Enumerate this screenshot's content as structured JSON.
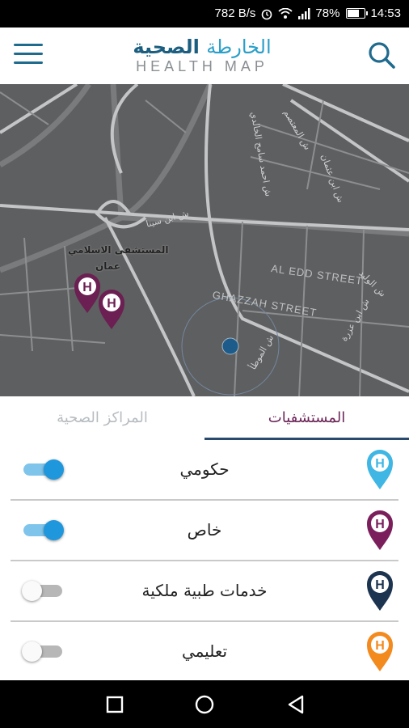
{
  "status_bar": {
    "net_speed": "782 B/s",
    "battery_text": "78%",
    "battery_level": 0.78,
    "time": "14:53",
    "icons": [
      "alarm-icon",
      "wifi-icon",
      "signal-icon",
      "battery-icon"
    ]
  },
  "header": {
    "logo_ar_light": "الخارطة",
    "logo_ar_bold": "الصحية",
    "logo_en": "HEALTH MAP",
    "menu_icon": "menu-icon",
    "search_icon": "search-icon"
  },
  "map": {
    "street_1": "AL EDD STREET",
    "street_2": "GHAZZAH STREET",
    "poi_name": "المستشفى الاسلامي",
    "poi_name_2": "عمان",
    "labels": [
      "ش ابن عزرة",
      "ش احمد سامح الخالدي",
      "ش المعتصم",
      "ش ابن سينا",
      "ش الوليد",
      "ش ابن عثمان",
      "ش الموطأ"
    ]
  },
  "tabs": {
    "centers": "المراكز الصحية",
    "hospitals": "المستشفيات",
    "active": "hospitals"
  },
  "categories": [
    {
      "label": "حكومي",
      "enabled": true,
      "pin_color": "#3fb6e3"
    },
    {
      "label": "خاص",
      "enabled": true,
      "pin_color": "#7a1f5c"
    },
    {
      "label": "خدمات طبية ملكية",
      "enabled": false,
      "pin_color": "#1d3450"
    },
    {
      "label": "تعليمي",
      "enabled": false,
      "pin_color": "#f28a1e"
    }
  ],
  "pin_letter": "H",
  "nav": {
    "back": "back-icon",
    "home": "home-icon",
    "recents": "recents-icon"
  }
}
